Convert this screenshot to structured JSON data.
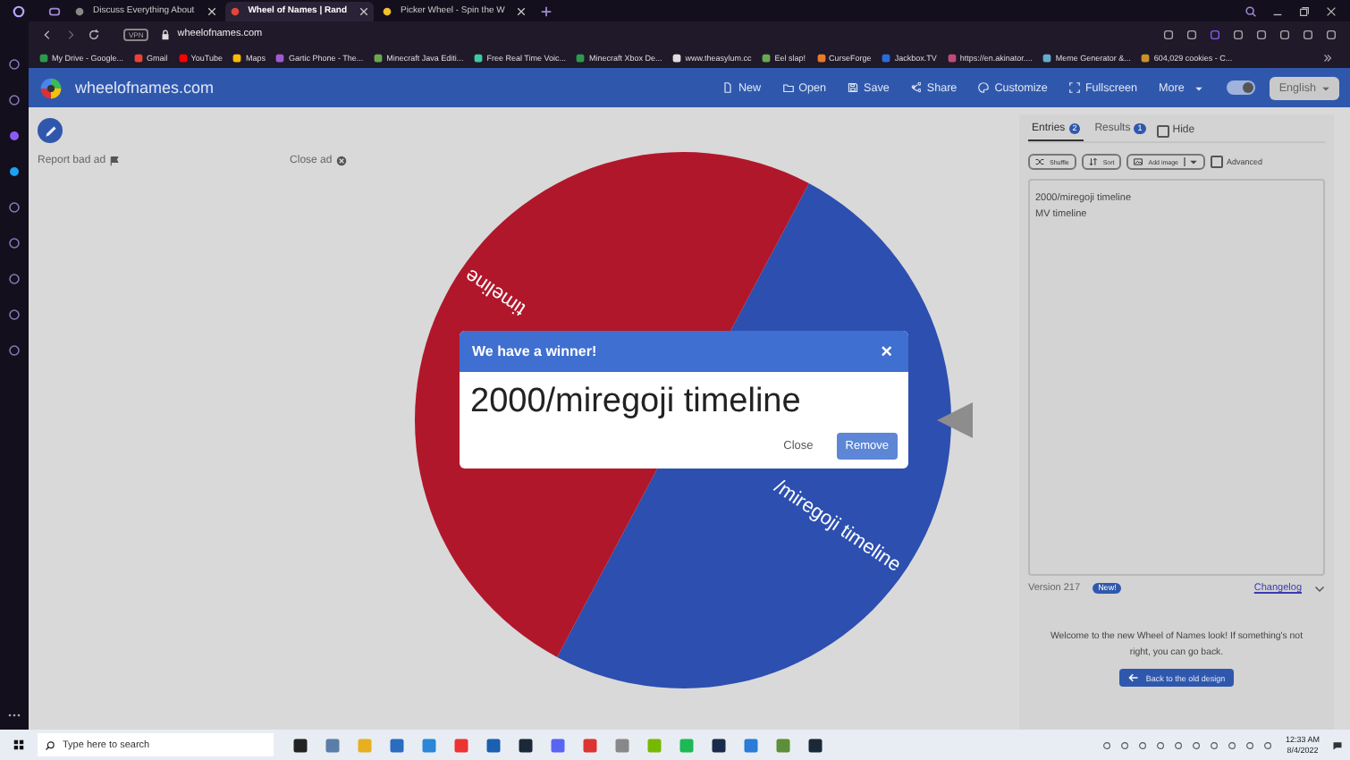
{
  "browser": {
    "tabs": [
      {
        "title": "Discuss Everything About",
        "selected": false
      },
      {
        "title": "Wheel of Names | Rand",
        "selected": true
      },
      {
        "title": "Picker Wheel - Spin the W",
        "selected": false
      }
    ],
    "vpn_badge": "VPN",
    "address": "wheelofnames.com",
    "bookmarks": [
      "My Drive - Google...",
      "Gmail",
      "YouTube",
      "Maps",
      "Gartic Phone - The...",
      "Minecraft Java Editi...",
      "Free Real Time Voic...",
      "Minecraft Xbox De...",
      "www.theasylum.cc",
      "Eel slap!",
      "CurseForge",
      "Jackbox.TV",
      "https://en.akinator....",
      "Meme Generator &...",
      "604,029 cookies - C..."
    ]
  },
  "app": {
    "site_name": "wheelofnames.com",
    "toolbar": [
      {
        "label": "New",
        "kind": "action"
      },
      {
        "label": "Open",
        "kind": "action"
      },
      {
        "label": "Save",
        "kind": "action"
      },
      {
        "label": "Share",
        "kind": "action"
      },
      {
        "label": "Customize",
        "kind": "action"
      },
      {
        "label": "Fullscreen",
        "kind": "action"
      },
      {
        "label": "More",
        "kind": "menu"
      }
    ],
    "dark_mode_toggle": {
      "on": true
    },
    "language": "English"
  },
  "ad": {
    "report": "Report bad ad",
    "close": "Close ad"
  },
  "wheel": {
    "slices": [
      {
        "label": "/miregoji timeline",
        "color": "#2c4fb0"
      },
      {
        "label": "timeline",
        "color": "#b1172b"
      }
    ]
  },
  "panel": {
    "tabs": [
      {
        "label": "Entries",
        "count": "2",
        "selected": true
      },
      {
        "label": "Results",
        "count": "1",
        "selected": false
      }
    ],
    "hide": {
      "label": "Hide",
      "checked": false
    },
    "tools": [
      {
        "label": "Shuffle",
        "kind": "plain"
      },
      {
        "label": "Sort",
        "kind": "plain"
      },
      {
        "label": "Add image",
        "kind": "split"
      }
    ],
    "advanced": {
      "label": "Advanced",
      "checked": false
    },
    "entries": [
      "2000/miregoji timeline",
      "MV timeline"
    ],
    "version": "Version 217",
    "version_badge": "New!",
    "changelog": "Changelog",
    "welcome": "Welcome to the new Wheel of Names look! If something's not right, you can go back.",
    "back_button": "Back to the old design"
  },
  "dialog": {
    "title": "We have a winner!",
    "close": "×",
    "winner": "2000/miregoji timeline",
    "buttons": [
      {
        "label": "Close",
        "kind": "text"
      },
      {
        "label": "Remove",
        "kind": "primary"
      }
    ]
  },
  "taskbar": {
    "search_placeholder": "Type here to search",
    "time": "12:33 AM",
    "date": "8/4/2022"
  }
}
